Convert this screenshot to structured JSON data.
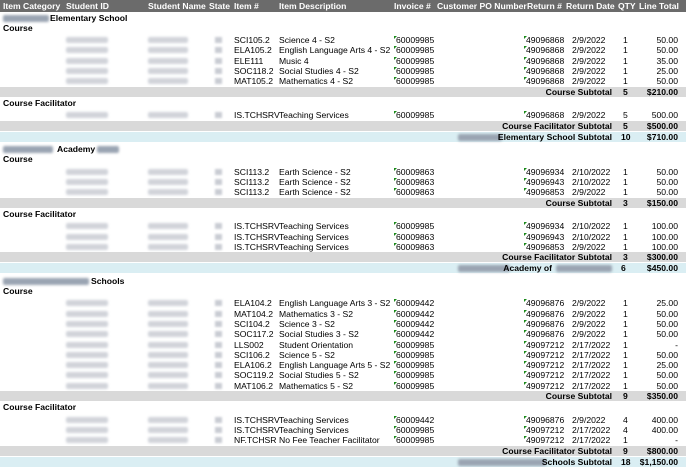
{
  "columns": [
    "Item Category",
    "Student ID",
    "Student Name",
    "State",
    "Item #",
    "Item Description",
    "Invoice #",
    "Customer PO Number",
    "Return #",
    "Return Date",
    "QTY",
    "Line Total"
  ],
  "groups": [
    {
      "school": "Elementary School",
      "sections": [
        {
          "name": "Course",
          "rows": [
            {
              "item": "SCI105.2",
              "desc": "Science 4 - S2",
              "inv": "60009985",
              "ret": "49096868",
              "date": "2/9/2022",
              "qty": "1",
              "total": "50.00"
            },
            {
              "item": "ELA105.2",
              "desc": "English Language Arts 4 - S2",
              "inv": "60009985",
              "ret": "49096868",
              "date": "2/9/2022",
              "qty": "1",
              "total": "50.00"
            },
            {
              "item": "ELE111",
              "desc": "Music 4",
              "inv": "60009985",
              "ret": "49096868",
              "date": "2/9/2022",
              "qty": "1",
              "total": "35.00"
            },
            {
              "item": "SOC118.2",
              "desc": "Social Studies 4 - S2",
              "inv": "60009985",
              "ret": "49096868",
              "date": "2/9/2022",
              "qty": "1",
              "total": "25.00"
            },
            {
              "item": "MAT105.2",
              "desc": "Mathematics 4 - S2",
              "inv": "60009985",
              "ret": "49096868",
              "date": "2/9/2022",
              "qty": "1",
              "total": "50.00"
            }
          ],
          "subtotal_label": "Course Subtotal",
          "subtotal_qty": "5",
          "subtotal_total": "$210.00"
        },
        {
          "name": "Course Facilitator",
          "rows": [
            {
              "item": "IS.TCHSRV",
              "desc": "Teaching Services",
              "inv": "60009985",
              "ret": "49096868",
              "date": "2/9/2022",
              "qty": "5",
              "total": "500.00"
            }
          ],
          "subtotal_label": "Course Facilitator Subtotal",
          "subtotal_qty": "5",
          "subtotal_total": "$500.00"
        }
      ],
      "total_label": "Elementary School Subtotal",
      "total_qty": "10",
      "total_total": "$710.00"
    },
    {
      "school": "Academy",
      "sections": [
        {
          "name": "Course",
          "rows": [
            {
              "item": "SCI113.2",
              "desc": "Earth Science - S2",
              "inv": "60009863",
              "ret": "49096934",
              "date": "2/10/2022",
              "qty": "1",
              "total": "50.00"
            },
            {
              "item": "SCI113.2",
              "desc": "Earth Science - S2",
              "inv": "60009863",
              "ret": "49096943",
              "date": "2/10/2022",
              "qty": "1",
              "total": "50.00"
            },
            {
              "item": "SCI113.2",
              "desc": "Earth Science - S2",
              "inv": "60009863",
              "ret": "49096853",
              "date": "2/9/2022",
              "qty": "1",
              "total": "50.00"
            }
          ],
          "subtotal_label": "Course Subtotal",
          "subtotal_qty": "3",
          "subtotal_total": "$150.00"
        },
        {
          "name": "Course Facilitator",
          "rows": [
            {
              "item": "IS.TCHSRV",
              "desc": "Teaching Services",
              "inv": "60009985",
              "ret": "49096934",
              "date": "2/10/2022",
              "qty": "1",
              "total": "100.00"
            },
            {
              "item": "IS.TCHSRV",
              "desc": "Teaching Services",
              "inv": "60009863",
              "ret": "49096943",
              "date": "2/10/2022",
              "qty": "1",
              "total": "100.00"
            },
            {
              "item": "IS.TCHSRV",
              "desc": "Teaching Services",
              "inv": "60009863",
              "ret": "49096853",
              "date": "2/9/2022",
              "qty": "1",
              "total": "100.00"
            }
          ],
          "subtotal_label": "Course Facilitator Subtotal",
          "subtotal_qty": "3",
          "subtotal_total": "$300.00"
        }
      ],
      "total_label": "Academy of",
      "total_qty": "6",
      "total_total": "$450.00"
    },
    {
      "school": "Schools",
      "sections": [
        {
          "name": "Course",
          "rows": [
            {
              "item": "ELA104.2",
              "desc": "English Language Arts 3 - S2",
              "inv": "60009442",
              "ret": "49096876",
              "date": "2/9/2022",
              "qty": "1",
              "total": "25.00"
            },
            {
              "item": "MAT104.2",
              "desc": "Mathematics 3 - S2",
              "inv": "60009442",
              "ret": "49096876",
              "date": "2/9/2022",
              "qty": "1",
              "total": "50.00"
            },
            {
              "item": "SCI104.2",
              "desc": "Science 3 - S2",
              "inv": "60009442",
              "ret": "49096876",
              "date": "2/9/2022",
              "qty": "1",
              "total": "50.00"
            },
            {
              "item": "SOC117.2",
              "desc": "Social Studies 3 - S2",
              "inv": "60009442",
              "ret": "49096876",
              "date": "2/9/2022",
              "qty": "1",
              "total": "50.00"
            },
            {
              "item": "LLS002",
              "desc": "Student Orientation",
              "inv": "60009985",
              "ret": "49097212",
              "date": "2/17/2022",
              "qty": "1",
              "total": "-"
            },
            {
              "item": "SCI106.2",
              "desc": "Science 5 - S2",
              "inv": "60009985",
              "ret": "49097212",
              "date": "2/17/2022",
              "qty": "1",
              "total": "50.00"
            },
            {
              "item": "ELA106.2",
              "desc": "English Language Arts 5 - S2",
              "inv": "60009985",
              "ret": "49097212",
              "date": "2/17/2022",
              "qty": "1",
              "total": "25.00"
            },
            {
              "item": "SOC119.2",
              "desc": "Social Studies 5 - S2",
              "inv": "60009985",
              "ret": "49097212",
              "date": "2/17/2022",
              "qty": "1",
              "total": "50.00"
            },
            {
              "item": "MAT106.2",
              "desc": "Mathematics 5 - S2",
              "inv": "60009985",
              "ret": "49097212",
              "date": "2/17/2022",
              "qty": "1",
              "total": "50.00"
            }
          ],
          "subtotal_label": "Course Subtotal",
          "subtotal_qty": "9",
          "subtotal_total": "$350.00"
        },
        {
          "name": "Course Facilitator",
          "rows": [
            {
              "item": "IS.TCHSRV",
              "desc": "Teaching Services",
              "inv": "60009442",
              "ret": "49096876",
              "date": "2/9/2022",
              "qty": "4",
              "total": "400.00"
            },
            {
              "item": "IS.TCHSRV",
              "desc": "Teaching Services",
              "inv": "60009985",
              "ret": "49097212",
              "date": "2/17/2022",
              "qty": "4",
              "total": "400.00"
            },
            {
              "item": "NF.TCHSR",
              "desc": "No Fee Teacher Facilitator",
              "inv": "60009985",
              "ret": "49097212",
              "date": "2/17/2022",
              "qty": "1",
              "total": "-"
            }
          ],
          "subtotal_label": "Course Facilitator Subtotal",
          "subtotal_qty": "9",
          "subtotal_total": "$800.00"
        }
      ],
      "total_label": "Schools Subtotal",
      "total_qty": "18",
      "total_total": "$1,150.00"
    }
  ]
}
